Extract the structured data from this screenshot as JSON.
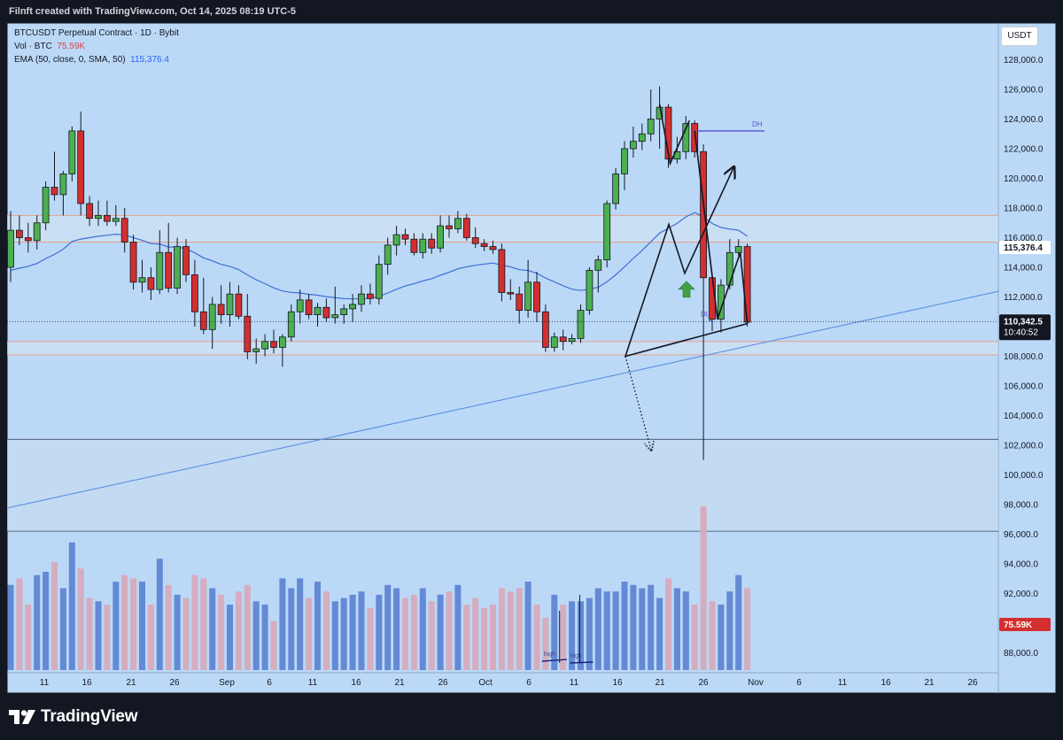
{
  "header": {
    "attribution": "Filnft created with TradingView.com, Oct 14, 2025 08:19 UTC-5"
  },
  "legend": {
    "symbol": "BTCUSDT Perpetual Contract · 1D · Bybit",
    "vol_label": "Vol · BTC",
    "vol_value": "75.59K",
    "ema_label": "EMA (50, close, 0, SMA, 50)",
    "ema_value": "115,376.4"
  },
  "axis": {
    "unit": "USDT",
    "y_ticks": [
      "128,000.0",
      "126,000.0",
      "124,000.0",
      "122,000.0",
      "120,000.0",
      "118,000.0",
      "116,000.0",
      "114,000.0",
      "112,000.0",
      "110,000.0",
      "108,000.0",
      "106,000.0",
      "104,000.0",
      "102,000.0",
      "100,000.0",
      "98,000.0",
      "96,000.0",
      "94,000.0",
      "92,000.0",
      "90,000.0",
      "88,000.0"
    ],
    "x_ticks": [
      "11",
      "16",
      "21",
      "26",
      "Sep",
      "6",
      "11",
      "16",
      "21",
      "26",
      "Oct",
      "6",
      "11",
      "16",
      "21",
      "26",
      "Nov",
      "6",
      "11",
      "16",
      "21",
      "26"
    ]
  },
  "price_labels": {
    "ema": "115,376.4",
    "last": "110,342.5",
    "countdown": "10:40:52",
    "volume": "75.59K"
  },
  "annotations": {
    "dh": "DH",
    "dl": "DL",
    "high1": "high",
    "high2": "high"
  },
  "brand": "TradingView",
  "colors": {
    "bull": "#4caf50",
    "bear": "#d32f2f",
    "vol_bull": "#5b7fd0",
    "vol_bear": "#d8a7b8",
    "ema": "#3d6ed6",
    "level": "#5b4fd1",
    "zone": "#e8a08f",
    "background": "#bbd9f7"
  },
  "chart_data": {
    "type": "candlestick",
    "ylim": [
      87000,
      129000
    ],
    "candles": [
      {
        "i": 0,
        "o": 114000,
        "h": 117800,
        "l": 113000,
        "c": 116500
      },
      {
        "i": 1,
        "o": 116500,
        "h": 117500,
        "l": 115500,
        "c": 116000
      },
      {
        "i": 2,
        "o": 116000,
        "h": 117000,
        "l": 115000,
        "c": 115800
      },
      {
        "i": 3,
        "o": 115800,
        "h": 117500,
        "l": 115200,
        "c": 117000
      },
      {
        "i": 4,
        "o": 117000,
        "h": 119800,
        "l": 116500,
        "c": 119400
      },
      {
        "i": 5,
        "o": 119400,
        "h": 121800,
        "l": 118500,
        "c": 118900
      },
      {
        "i": 6,
        "o": 118900,
        "h": 120500,
        "l": 117500,
        "c": 120300
      },
      {
        "i": 7,
        "o": 120300,
        "h": 123500,
        "l": 119800,
        "c": 123200
      },
      {
        "i": 8,
        "o": 123200,
        "h": 124500,
        "l": 117500,
        "c": 118300
      },
      {
        "i": 9,
        "o": 118300,
        "h": 118800,
        "l": 116800,
        "c": 117300
      },
      {
        "i": 10,
        "o": 117300,
        "h": 118500,
        "l": 116800,
        "c": 117500
      },
      {
        "i": 11,
        "o": 117500,
        "h": 118500,
        "l": 116800,
        "c": 117100
      },
      {
        "i": 12,
        "o": 117100,
        "h": 118200,
        "l": 116800,
        "c": 117300
      },
      {
        "i": 13,
        "o": 117300,
        "h": 118000,
        "l": 115000,
        "c": 115700
      },
      {
        "i": 14,
        "o": 115700,
        "h": 116200,
        "l": 112500,
        "c": 113000
      },
      {
        "i": 15,
        "o": 113000,
        "h": 114500,
        "l": 112300,
        "c": 113300
      },
      {
        "i": 16,
        "o": 113300,
        "h": 114000,
        "l": 111800,
        "c": 112500
      },
      {
        "i": 17,
        "o": 112500,
        "h": 116500,
        "l": 112200,
        "c": 115000
      },
      {
        "i": 18,
        "o": 115000,
        "h": 117000,
        "l": 112300,
        "c": 112600
      },
      {
        "i": 19,
        "o": 112600,
        "h": 116000,
        "l": 112200,
        "c": 115400
      },
      {
        "i": 20,
        "o": 115400,
        "h": 115900,
        "l": 113000,
        "c": 113500
      },
      {
        "i": 21,
        "o": 113500,
        "h": 114500,
        "l": 110000,
        "c": 111000
      },
      {
        "i": 22,
        "o": 111000,
        "h": 113300,
        "l": 109500,
        "c": 109800
      },
      {
        "i": 23,
        "o": 109800,
        "h": 112000,
        "l": 108500,
        "c": 111500
      },
      {
        "i": 24,
        "o": 111500,
        "h": 112800,
        "l": 110200,
        "c": 110800
      },
      {
        "i": 25,
        "o": 110800,
        "h": 113000,
        "l": 110000,
        "c": 112200
      },
      {
        "i": 26,
        "o": 112200,
        "h": 112800,
        "l": 110500,
        "c": 110700
      },
      {
        "i": 27,
        "o": 110700,
        "h": 112200,
        "l": 107800,
        "c": 108300
      },
      {
        "i": 28,
        "o": 108300,
        "h": 109200,
        "l": 107500,
        "c": 108500
      },
      {
        "i": 29,
        "o": 108500,
        "h": 109500,
        "l": 108000,
        "c": 109000
      },
      {
        "i": 30,
        "o": 109000,
        "h": 109800,
        "l": 108200,
        "c": 108600
      },
      {
        "i": 31,
        "o": 108600,
        "h": 109500,
        "l": 107300,
        "c": 109300
      },
      {
        "i": 32,
        "o": 109300,
        "h": 111500,
        "l": 109000,
        "c": 111000
      },
      {
        "i": 33,
        "o": 111000,
        "h": 112500,
        "l": 110200,
        "c": 111800
      },
      {
        "i": 34,
        "o": 111800,
        "h": 112200,
        "l": 110500,
        "c": 110800
      },
      {
        "i": 35,
        "o": 110800,
        "h": 111600,
        "l": 110000,
        "c": 111300
      },
      {
        "i": 36,
        "o": 111300,
        "h": 111900,
        "l": 110300,
        "c": 110600
      },
      {
        "i": 37,
        "o": 110600,
        "h": 112700,
        "l": 110200,
        "c": 110800
      },
      {
        "i": 38,
        "o": 110800,
        "h": 111500,
        "l": 110200,
        "c": 111200
      },
      {
        "i": 39,
        "o": 111200,
        "h": 112200,
        "l": 110300,
        "c": 111500
      },
      {
        "i": 40,
        "o": 111500,
        "h": 112800,
        "l": 111000,
        "c": 112200
      },
      {
        "i": 41,
        "o": 112200,
        "h": 112900,
        "l": 111500,
        "c": 111900
      },
      {
        "i": 42,
        "o": 111900,
        "h": 114800,
        "l": 111500,
        "c": 114200
      },
      {
        "i": 43,
        "o": 114200,
        "h": 116000,
        "l": 113500,
        "c": 115500
      },
      {
        "i": 44,
        "o": 115500,
        "h": 116800,
        "l": 114800,
        "c": 116200
      },
      {
        "i": 45,
        "o": 116200,
        "h": 116600,
        "l": 115500,
        "c": 115900
      },
      {
        "i": 46,
        "o": 115900,
        "h": 116300,
        "l": 114800,
        "c": 115000
      },
      {
        "i": 47,
        "o": 115000,
        "h": 116300,
        "l": 114600,
        "c": 115900
      },
      {
        "i": 48,
        "o": 115900,
        "h": 116300,
        "l": 114900,
        "c": 115300
      },
      {
        "i": 49,
        "o": 115300,
        "h": 117500,
        "l": 115000,
        "c": 116800
      },
      {
        "i": 50,
        "o": 116800,
        "h": 117500,
        "l": 116000,
        "c": 116600
      },
      {
        "i": 51,
        "o": 116600,
        "h": 117800,
        "l": 116300,
        "c": 117300
      },
      {
        "i": 52,
        "o": 117300,
        "h": 117600,
        "l": 115800,
        "c": 116000
      },
      {
        "i": 53,
        "o": 116000,
        "h": 116700,
        "l": 115300,
        "c": 115600
      },
      {
        "i": 54,
        "o": 115600,
        "h": 115900,
        "l": 115100,
        "c": 115400
      },
      {
        "i": 55,
        "o": 115400,
        "h": 115800,
        "l": 114900,
        "c": 115200
      },
      {
        "i": 56,
        "o": 115200,
        "h": 115600,
        "l": 111700,
        "c": 112300
      },
      {
        "i": 57,
        "o": 112300,
        "h": 113200,
        "l": 111800,
        "c": 112200
      },
      {
        "i": 58,
        "o": 112200,
        "h": 112700,
        "l": 110200,
        "c": 111100
      },
      {
        "i": 59,
        "o": 111100,
        "h": 114500,
        "l": 110600,
        "c": 113000
      },
      {
        "i": 60,
        "o": 113000,
        "h": 113700,
        "l": 110300,
        "c": 111000
      },
      {
        "i": 61,
        "o": 111000,
        "h": 111500,
        "l": 108300,
        "c": 108600
      },
      {
        "i": 62,
        "o": 108600,
        "h": 109600,
        "l": 108300,
        "c": 109300
      },
      {
        "i": 63,
        "o": 109300,
        "h": 109800,
        "l": 108400,
        "c": 109000
      },
      {
        "i": 64,
        "o": 109000,
        "h": 109500,
        "l": 108800,
        "c": 109200
      },
      {
        "i": 65,
        "o": 109200,
        "h": 111500,
        "l": 108900,
        "c": 111100
      },
      {
        "i": 66,
        "o": 111100,
        "h": 114000,
        "l": 110800,
        "c": 113800
      },
      {
        "i": 67,
        "o": 113800,
        "h": 114800,
        "l": 112300,
        "c": 114500
      },
      {
        "i": 68,
        "o": 114500,
        "h": 118500,
        "l": 114000,
        "c": 118300
      },
      {
        "i": 69,
        "o": 118300,
        "h": 120700,
        "l": 117900,
        "c": 120300
      },
      {
        "i": 70,
        "o": 120300,
        "h": 122500,
        "l": 119200,
        "c": 122000
      },
      {
        "i": 71,
        "o": 122000,
        "h": 123500,
        "l": 121400,
        "c": 122500
      },
      {
        "i": 72,
        "o": 122500,
        "h": 123700,
        "l": 121900,
        "c": 123000
      },
      {
        "i": 73,
        "o": 123000,
        "h": 126000,
        "l": 122500,
        "c": 124000
      },
      {
        "i": 74,
        "o": 124000,
        "h": 126200,
        "l": 122000,
        "c": 124800
      },
      {
        "i": 75,
        "o": 124800,
        "h": 125000,
        "l": 120700,
        "c": 121300
      },
      {
        "i": 76,
        "o": 121300,
        "h": 122800,
        "l": 121000,
        "c": 121800
      },
      {
        "i": 77,
        "o": 121800,
        "h": 124200,
        "l": 121300,
        "c": 123700
      },
      {
        "i": 78,
        "o": 123700,
        "h": 123900,
        "l": 121400,
        "c": 121800
      },
      {
        "i": 79,
        "o": 121800,
        "h": 122300,
        "l": 101000,
        "c": 113300
      },
      {
        "i": 80,
        "o": 113300,
        "h": 113600,
        "l": 109700,
        "c": 110500
      },
      {
        "i": 81,
        "o": 110500,
        "h": 113200,
        "l": 109600,
        "c": 112800
      },
      {
        "i": 82,
        "o": 112800,
        "h": 115900,
        "l": 112500,
        "c": 115000
      },
      {
        "i": 83,
        "o": 115000,
        "h": 115900,
        "l": 114800,
        "c": 115400
      },
      {
        "i": 84,
        "o": 115400,
        "h": 115600,
        "l": 110000,
        "c": 110300
      }
    ],
    "volume": [
      52,
      56,
      40,
      58,
      60,
      66,
      50,
      78,
      62,
      44,
      42,
      40,
      54,
      58,
      56,
      54,
      40,
      68,
      52,
      46,
      44,
      58,
      56,
      50,
      46,
      40,
      48,
      52,
      42,
      40,
      30,
      56,
      50,
      56,
      44,
      54,
      48,
      42,
      44,
      46,
      48,
      38,
      46,
      52,
      50,
      44,
      46,
      50,
      42,
      46,
      48,
      52,
      40,
      44,
      38,
      40,
      50,
      48,
      50,
      54,
      40,
      32,
      46,
      40,
      42,
      42,
      44,
      50,
      48,
      48,
      54,
      52,
      50,
      52,
      44,
      56,
      50,
      48,
      40,
      100,
      42,
      40,
      48,
      58,
      50
    ]
  }
}
